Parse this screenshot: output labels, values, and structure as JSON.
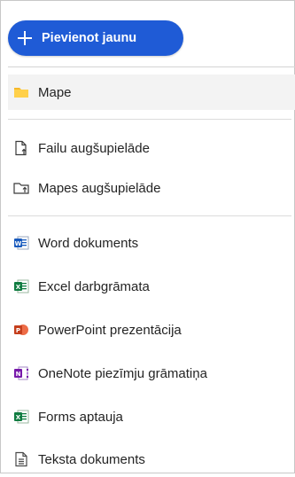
{
  "new_button": {
    "label": "Pievienot jaunu"
  },
  "menu": {
    "folders": {
      "label": "Mape"
    },
    "upload_files": {
      "label": "Failu augšupielāde"
    },
    "upload_folder": {
      "label": "Mapes augšupielāde"
    },
    "word": {
      "label": "Word dokuments"
    },
    "excel": {
      "label": "Excel darbgrāmata"
    },
    "powerpoint": {
      "label": "PowerPoint prezentācija"
    },
    "onenote": {
      "label": "OneNote piezīmju grāmatiņa"
    },
    "forms": {
      "label": "Forms aptauja"
    },
    "text": {
      "label": "Teksta dokuments"
    }
  },
  "colors": {
    "accent": "#1f5bd6",
    "folder": "#f6b829",
    "word": "#185abd",
    "excel": "#107c41",
    "powerpoint": "#c43e1c",
    "onenote": "#7719aa",
    "forms": "#107c41"
  }
}
